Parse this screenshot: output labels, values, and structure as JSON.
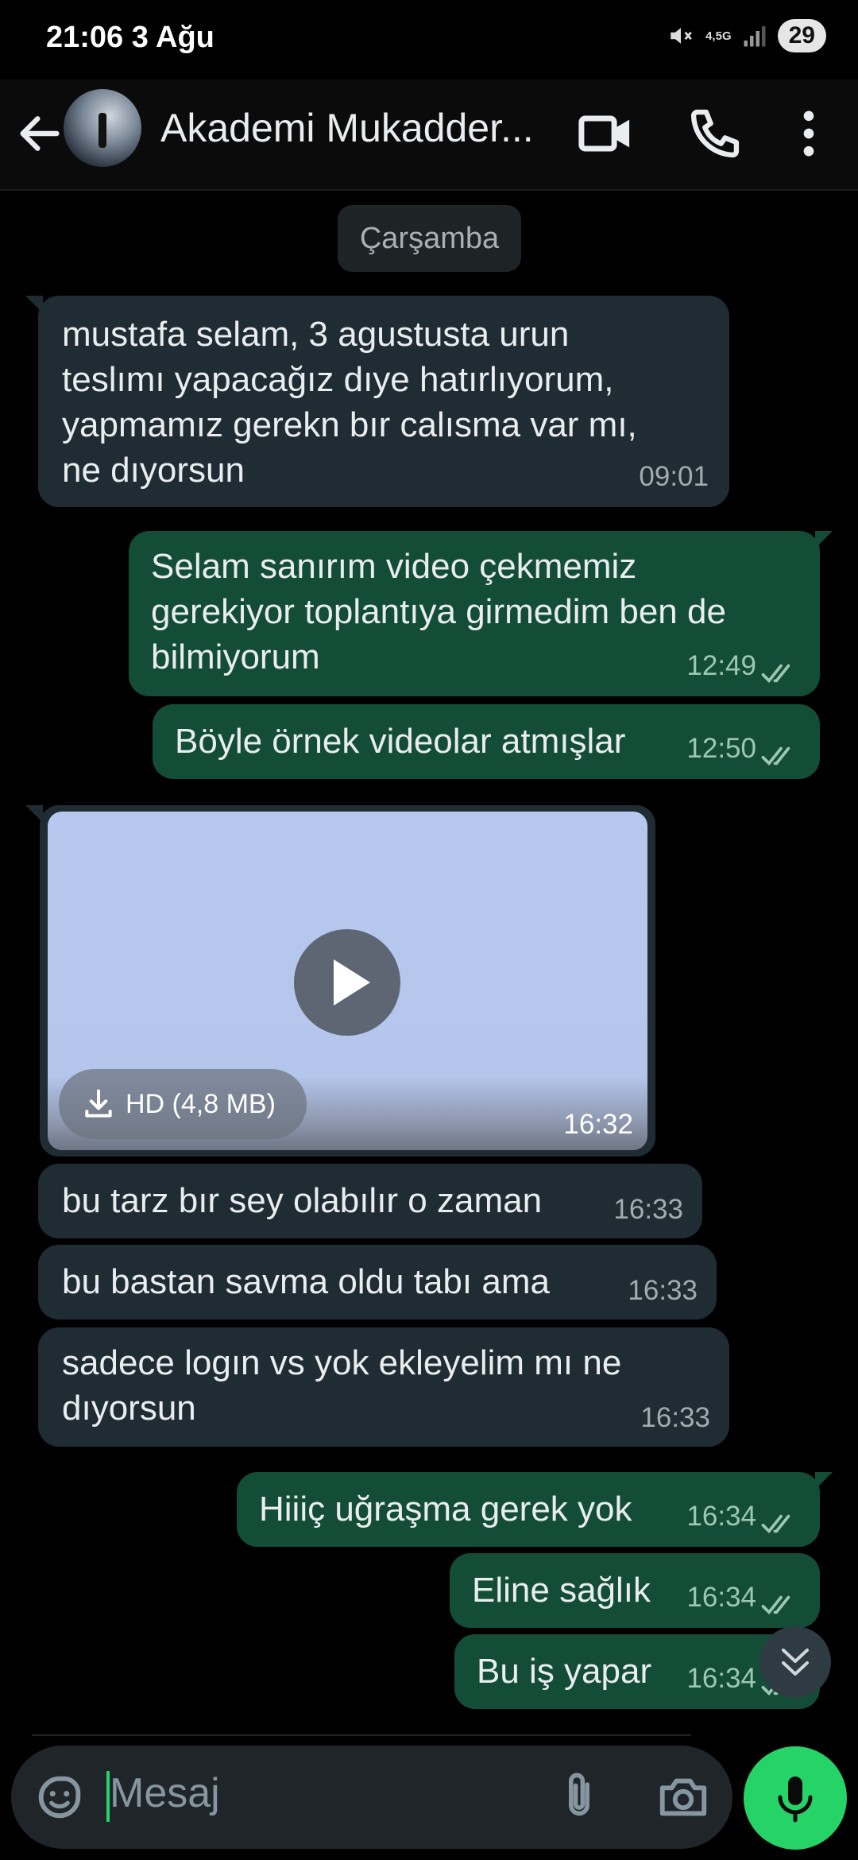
{
  "status_bar": {
    "time": "21:06  3 Ağu",
    "network": "4,5G",
    "battery": "29"
  },
  "header": {
    "title": "Akademi Mukadder..."
  },
  "date_chip": "Çarşamba",
  "messages": [
    {
      "dir": "in",
      "text": "mustafa selam, 3 agustusta urun\nteslımı yapacağız dıye hatırlıyorum,\nyapmamız gerekn bır calısma var mı,\nne dıyorsun",
      "time": "09:01"
    },
    {
      "dir": "out",
      "text": "Selam sanırım video çekmemiz\ngerekiyor toplantıya girmedim ben de\nbilmiyorum",
      "time": "12:49"
    },
    {
      "dir": "out",
      "text": "Böyle örnek videolar atmışlar",
      "time": "12:50"
    },
    {
      "dir": "in",
      "type": "video",
      "download_label": "HD (4,8 MB)",
      "time": "16:32"
    },
    {
      "dir": "in",
      "text": "bu tarz bır sey olabılır o zaman",
      "time": "16:33"
    },
    {
      "dir": "in",
      "text": "bu bastan savma oldu tabı ama",
      "time": "16:33"
    },
    {
      "dir": "in",
      "text": "sadece logın vs yok ekleyelim mı ne\ndıyorsun",
      "time": "16:33"
    },
    {
      "dir": "out",
      "text": "Hiiiç uğraşma gerek yok",
      "time": "16:34"
    },
    {
      "dir": "out",
      "text": "Eline sağlık",
      "time": "16:34"
    },
    {
      "dir": "out",
      "text": "Bu iş yapar",
      "time": "16:34"
    }
  ],
  "composer": {
    "placeholder": "Mesaj"
  },
  "colors": {
    "incoming": "#202c33",
    "outgoing": "#144d37",
    "accent": "#25d366",
    "background": "#000000"
  },
  "icons": [
    "back-arrow-icon",
    "video-call-icon",
    "phone-icon",
    "more-vert-icon",
    "download-icon",
    "play-icon",
    "double-check-icon",
    "chevron-double-down-icon",
    "sticker-icon",
    "attach-icon",
    "camera-icon",
    "mic-icon"
  ]
}
